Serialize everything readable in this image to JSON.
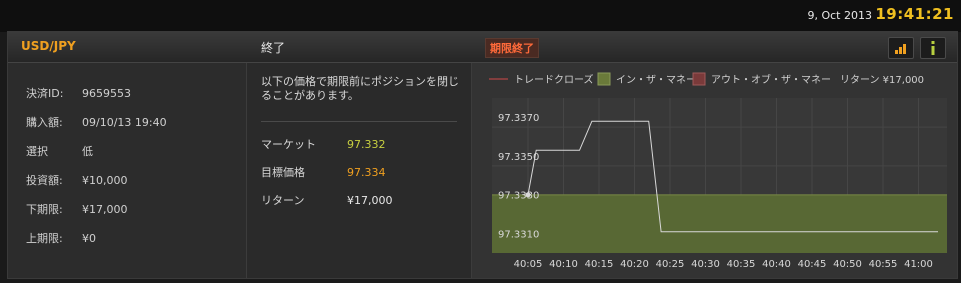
{
  "topbar": {
    "date": "9, Oct 2013",
    "time": "19:41:21"
  },
  "header": {
    "symbol": "USD/JPY",
    "status": "終了",
    "expired_badge": "期限終了"
  },
  "details": [
    {
      "label": "決済ID:",
      "value": "9659553"
    },
    {
      "label": "購入額:",
      "value": "09/10/13 19:40"
    },
    {
      "label": "選択",
      "value": "低"
    },
    {
      "label": "投資額:",
      "value": "¥10,000"
    },
    {
      "label": "下期限:",
      "value": "¥17,000"
    },
    {
      "label": "上期限:",
      "value": "¥0"
    }
  ],
  "summary": {
    "notice": "以下の価格で期限前にポジションを閉じることがあります。",
    "market_label": "マーケット",
    "market_value": "97.332",
    "target_label": "目標価格",
    "target_value": "97.334",
    "return_label": "リターン",
    "return_value": "¥17,000"
  },
  "legend": {
    "close": "トレードクローズ",
    "in_money": "イン・ザ・マネー",
    "out_money": "アウト・オブ・ザ・マネー",
    "return": "リターン ¥17,000"
  },
  "colors": {
    "accent": "#f0a020",
    "clock": "#f0c020",
    "in_money": "#5a6a34",
    "out_money": "#7a3a3a",
    "value_green": "#c8d040"
  },
  "icons": {
    "signal": "signal-bars-icon",
    "info": "info-icon"
  },
  "chart_data": {
    "type": "line",
    "x": [
      "40:05",
      "40:10",
      "40:15",
      "40:20",
      "40:25",
      "40:30",
      "40:35",
      "40:40",
      "40:45",
      "40:50",
      "40:55",
      "41:00"
    ],
    "ylim": [
      97.3305,
      97.3385
    ],
    "yticks": [
      "97.3370",
      "97.3350",
      "97.3330",
      "97.3310"
    ],
    "in_money_band": [
      97.3305,
      97.3335
    ],
    "series": [
      {
        "points": [
          [
            0,
            97.3335
          ],
          [
            0.23,
            97.3358
          ],
          [
            1.45,
            97.3358
          ],
          [
            1.8,
            97.3373
          ],
          [
            3.4,
            97.3373
          ],
          [
            3.75,
            97.3316
          ],
          [
            4.2,
            97.3316
          ],
          [
            11.55,
            97.3316
          ]
        ]
      }
    ]
  }
}
